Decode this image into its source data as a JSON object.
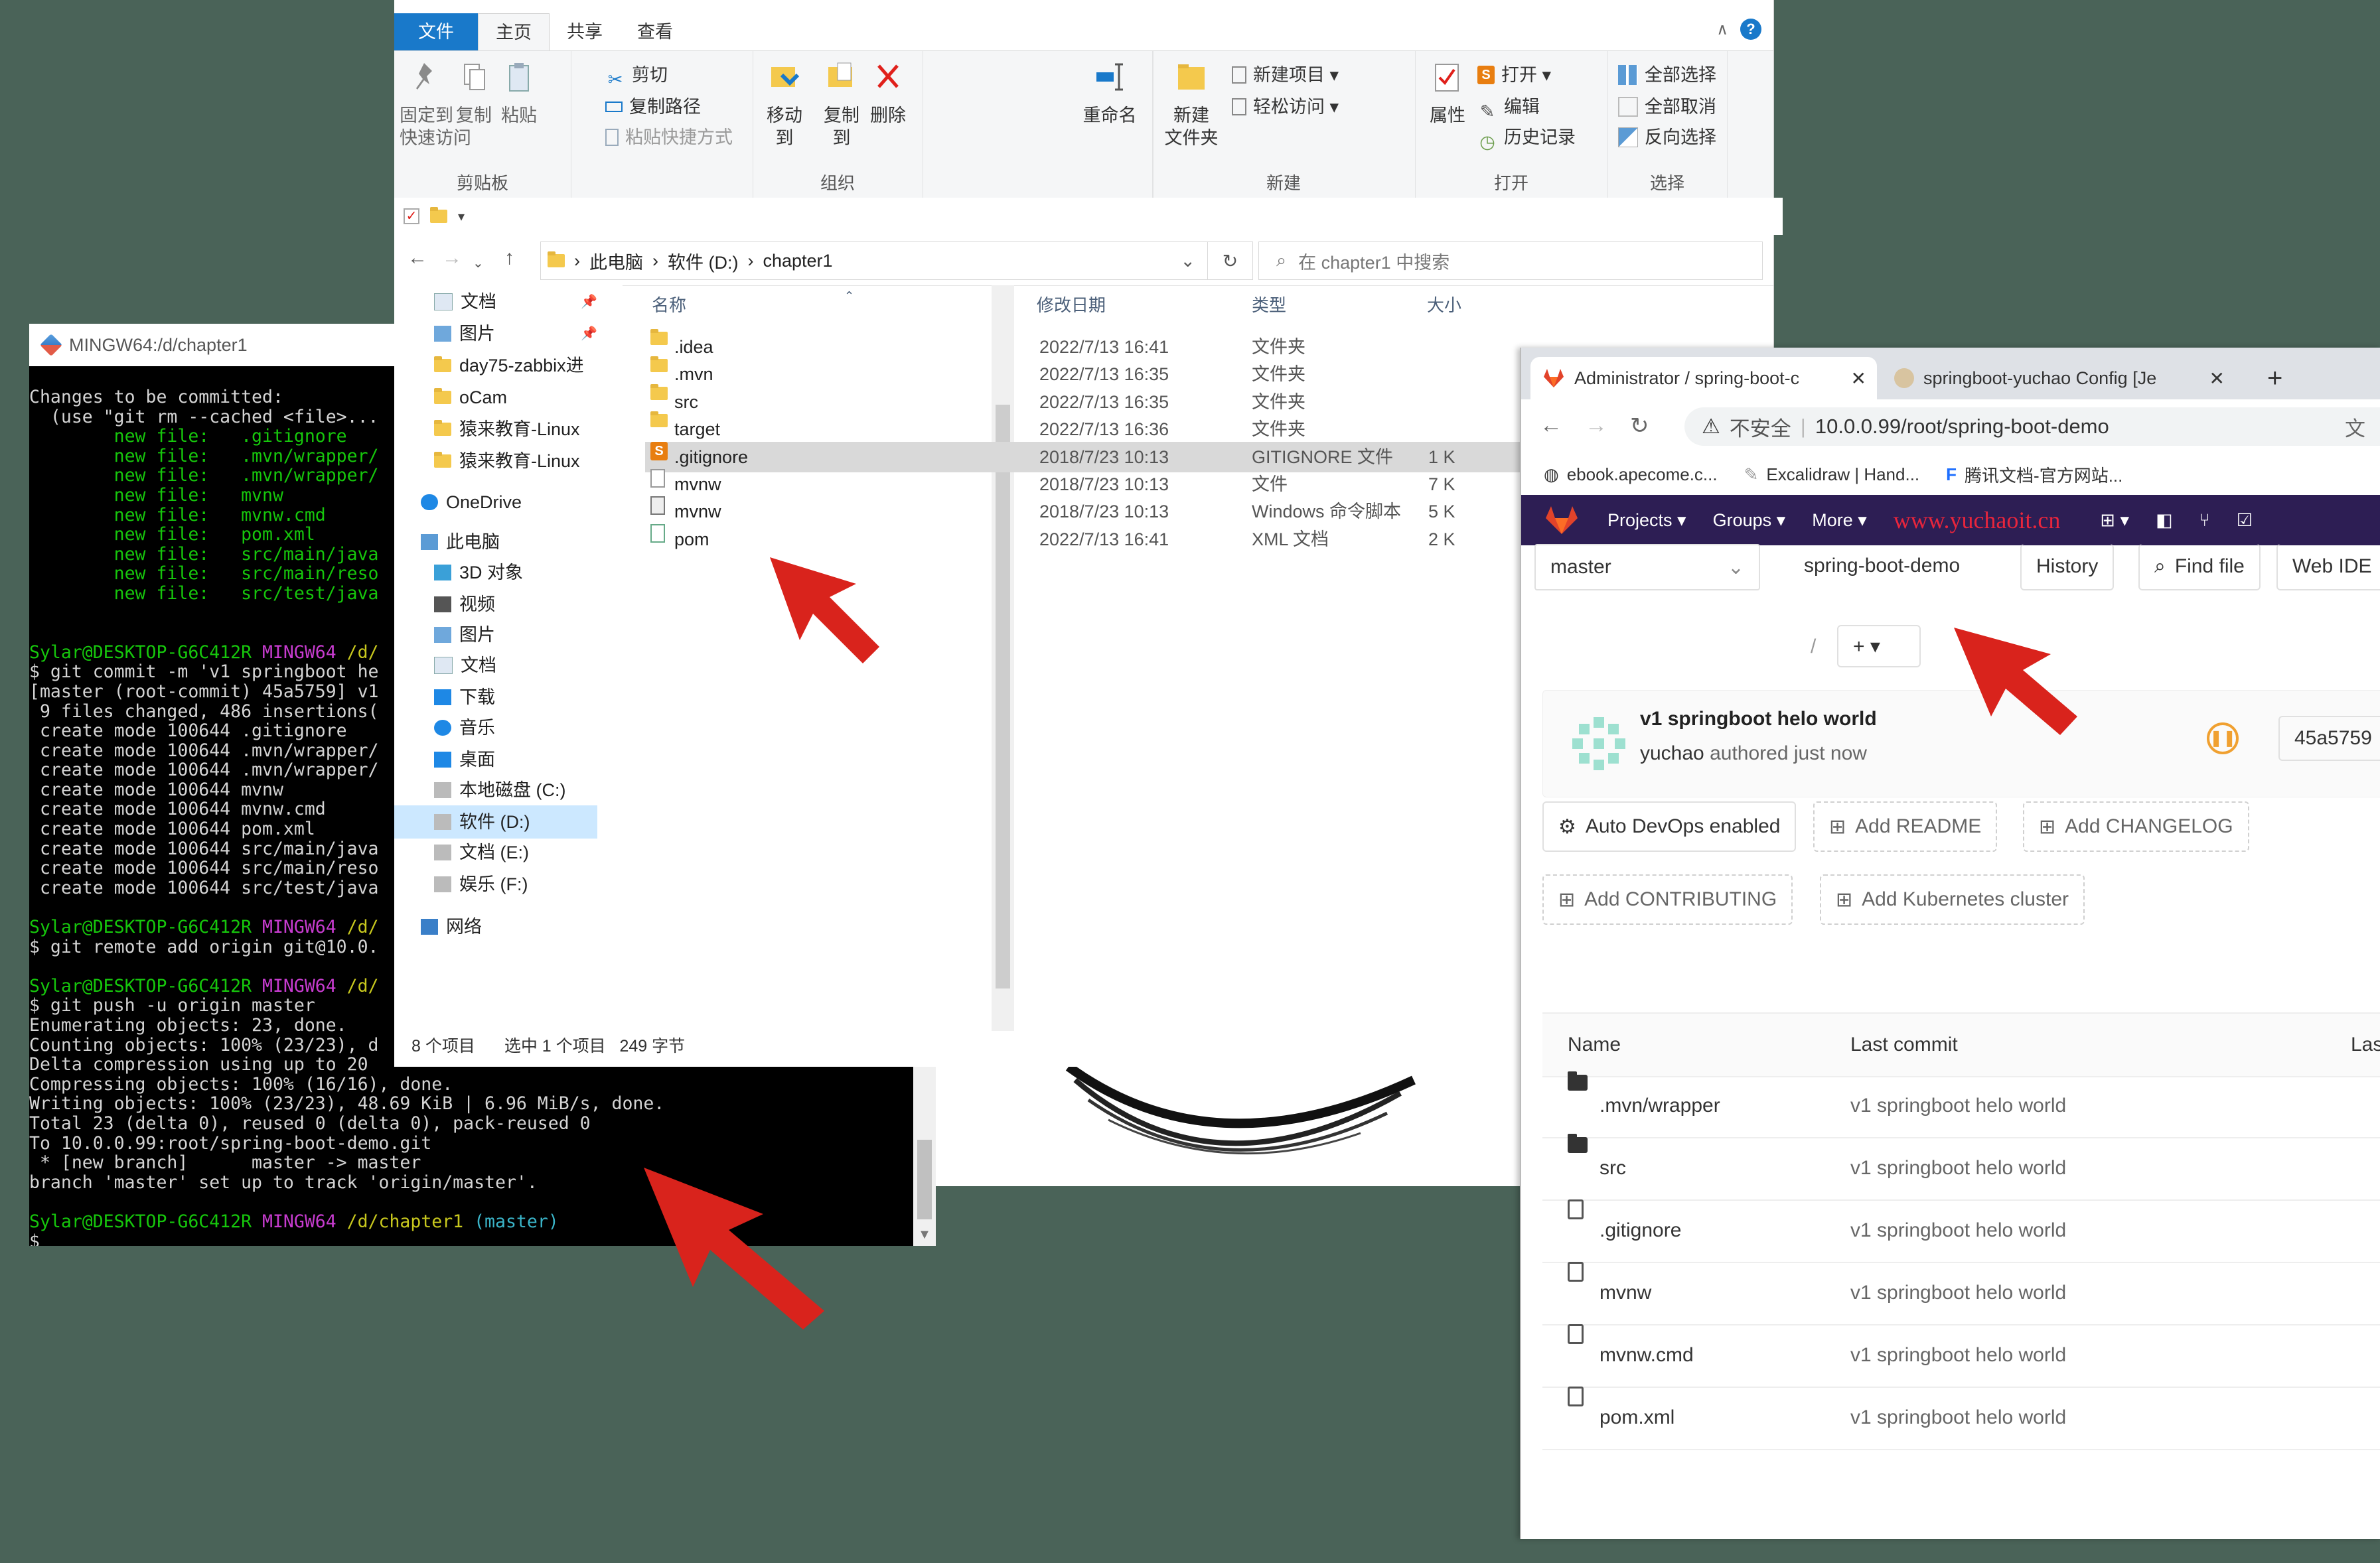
{
  "terminal": {
    "title": "MINGW64:/d/chapter1",
    "lines": [
      [
        [
          "Changes to be committed:",
          ""
        ]
      ],
      [
        [
          "  (use \"git rm --cached <file>...",
          ""
        ]
      ],
      [
        [
          "        new file:   .gitignore",
          "g"
        ]
      ],
      [
        [
          "        new file:   .mvn/wrapper/",
          "g"
        ]
      ],
      [
        [
          "        new file:   .mvn/wrapper/",
          "g"
        ]
      ],
      [
        [
          "        new file:   mvnw",
          "g"
        ]
      ],
      [
        [
          "        new file:   mvnw.cmd",
          "g"
        ]
      ],
      [
        [
          "        new file:   pom.xml",
          "g"
        ]
      ],
      [
        [
          "        new file:   src/main/java",
          "g"
        ]
      ],
      [
        [
          "        new file:   src/main/reso",
          "g"
        ]
      ],
      [
        [
          "        new file:   src/test/java",
          "g"
        ]
      ],
      [
        [
          "",
          ""
        ]
      ],
      [
        [
          "",
          ""
        ]
      ],
      [
        [
          "Sylar@DESKTOP-G6C412R ",
          "g"
        ],
        [
          "MINGW64 ",
          "p"
        ],
        [
          "/d/",
          "y"
        ]
      ],
      [
        [
          "$ git commit -m 'v1 springboot he",
          ""
        ]
      ],
      [
        [
          "[master (root-commit) 45a5759] v1",
          ""
        ]
      ],
      [
        [
          " 9 files changed, 486 insertions(",
          ""
        ]
      ],
      [
        [
          " create mode 100644 .gitignore",
          ""
        ]
      ],
      [
        [
          " create mode 100644 .mvn/wrapper/",
          ""
        ]
      ],
      [
        [
          " create mode 100644 .mvn/wrapper/",
          ""
        ]
      ],
      [
        [
          " create mode 100644 mvnw",
          ""
        ]
      ],
      [
        [
          " create mode 100644 mvnw.cmd",
          ""
        ]
      ],
      [
        [
          " create mode 100644 pom.xml",
          ""
        ]
      ],
      [
        [
          " create mode 100644 src/main/java",
          ""
        ]
      ],
      [
        [
          " create mode 100644 src/main/reso",
          ""
        ]
      ],
      [
        [
          " create mode 100644 src/test/java",
          ""
        ]
      ],
      [
        [
          "",
          ""
        ]
      ],
      [
        [
          "Sylar@DESKTOP-G6C412R ",
          "g"
        ],
        [
          "MINGW64 ",
          "p"
        ],
        [
          "/d/",
          "y"
        ]
      ],
      [
        [
          "$ git remote add origin git@10.0.",
          ""
        ]
      ],
      [
        [
          "",
          ""
        ]
      ],
      [
        [
          "Sylar@DESKTOP-G6C412R ",
          "g"
        ],
        [
          "MINGW64 ",
          "p"
        ],
        [
          "/d/",
          "y"
        ]
      ],
      [
        [
          "$ git push -u origin master",
          ""
        ]
      ],
      [
        [
          "Enumerating objects: 23, done.",
          ""
        ]
      ],
      [
        [
          "Counting objects: 100% (23/23), d",
          ""
        ]
      ],
      [
        [
          "Delta compression using up to 20",
          ""
        ]
      ],
      [
        [
          "Compressing objects: 100% (16/16), done.",
          ""
        ]
      ],
      [
        [
          "Writing objects: 100% (23/23), 48.69 KiB | 6.96 MiB/s, done.",
          ""
        ]
      ],
      [
        [
          "Total 23 (delta 0), reused 0 (delta 0), pack-reused 0",
          ""
        ]
      ],
      [
        [
          "To 10.0.0.99:root/spring-boot-demo.git",
          ""
        ]
      ],
      [
        [
          " * [new branch]      master -> master",
          ""
        ]
      ],
      [
        [
          "branch 'master' set up to track 'origin/master'.",
          ""
        ]
      ],
      [
        [
          "",
          ""
        ]
      ],
      [
        [
          "Sylar@DESKTOP-G6C412R ",
          "g"
        ],
        [
          "MINGW64 ",
          "p"
        ],
        [
          "/d/chapter1 ",
          "y"
        ],
        [
          "(master)",
          "c"
        ]
      ],
      [
        [
          "$ ",
          ""
        ]
      ]
    ]
  },
  "explorer": {
    "tabs": [
      "文件",
      "主页",
      "共享",
      "查看"
    ],
    "ribbon": {
      "clipboard": {
        "name": "剪贴板",
        "pin": "固定到\n快速访问",
        "copy": "复制",
        "paste": "粘贴",
        "cut": "剪切",
        "copy_path": "复制路径",
        "paste_shortcut": "粘贴快捷方式"
      },
      "organize": {
        "name": "组织",
        "move_to": "移动到",
        "copy_to": "复制到",
        "delete": "删除",
        "rename": "重命名"
      },
      "new": {
        "name": "新建",
        "new_folder": "新建\n文件夹",
        "new_item": "新建项目 ▾",
        "easy_access": "轻松访问 ▾"
      },
      "open": {
        "name": "打开",
        "properties": "属性",
        "open": "打开 ▾",
        "edit": "编辑",
        "history": "历史记录"
      },
      "select": {
        "name": "选择",
        "select_all": "全部选择",
        "select_none": "全部取消",
        "invert": "反向选择"
      }
    },
    "address": {
      "parts": [
        "此电脑",
        "软件 (D:)",
        "chapter1"
      ],
      "search_placeholder": "在 chapter1 中搜索"
    },
    "nav": [
      {
        "label": "文档",
        "icon": "doc-icon",
        "pinned": true
      },
      {
        "label": "图片",
        "icon": "pictures-icon",
        "pinned": true
      },
      {
        "label": "day75-zabbix进",
        "icon": "folder-icon"
      },
      {
        "label": "oCam",
        "icon": "folder-icon"
      },
      {
        "label": "猿来教育-Linux",
        "icon": "folder-icon"
      },
      {
        "label": "猿来教育-Linux",
        "icon": "folder-icon"
      },
      {
        "label": "OneDrive",
        "icon": "cloud-icon"
      },
      {
        "label": "此电脑",
        "icon": "pc-icon"
      },
      {
        "label": "3D 对象",
        "icon": "3d-icon"
      },
      {
        "label": "视频",
        "icon": "video-icon"
      },
      {
        "label": "图片",
        "icon": "pictures-icon"
      },
      {
        "label": "文档",
        "icon": "doc-icon"
      },
      {
        "label": "下载",
        "icon": "download-icon"
      },
      {
        "label": "音乐",
        "icon": "music-icon"
      },
      {
        "label": "桌面",
        "icon": "desktop-icon"
      },
      {
        "label": "本地磁盘 (C:)",
        "icon": "drive-icon"
      },
      {
        "label": "软件 (D:)",
        "icon": "drive-icon",
        "selected": true
      },
      {
        "label": "文档 (E:)",
        "icon": "drive-icon"
      },
      {
        "label": "娱乐 (F:)",
        "icon": "drive-icon"
      },
      {
        "label": "网络",
        "icon": "network-icon"
      }
    ],
    "columns": [
      "名称",
      "修改日期",
      "类型",
      "大小"
    ],
    "files": [
      {
        "name": ".idea",
        "date": "2022/7/13 16:41",
        "type": "文件夹",
        "size": "",
        "kind": "folder"
      },
      {
        "name": ".mvn",
        "date": "2022/7/13 16:35",
        "type": "文件夹",
        "size": "",
        "kind": "folder"
      },
      {
        "name": "src",
        "date": "2022/7/13 16:35",
        "type": "文件夹",
        "size": "",
        "kind": "folder"
      },
      {
        "name": "target",
        "date": "2022/7/13 16:36",
        "type": "文件夹",
        "size": "",
        "kind": "folder"
      },
      {
        "name": ".gitignore",
        "date": "2018/7/23 10:13",
        "type": "GITIGNORE 文件",
        "size": "1 K",
        "kind": "sublime",
        "selected": true
      },
      {
        "name": "mvnw",
        "date": "2018/7/23 10:13",
        "type": "文件",
        "size": "7 K",
        "kind": "doc"
      },
      {
        "name": "mvnw",
        "date": "2018/7/23 10:13",
        "type": "Windows 命令脚本",
        "size": "5 K",
        "kind": "cmd"
      },
      {
        "name": "pom",
        "date": "2022/7/13 16:41",
        "type": "XML 文档",
        "size": "2 K",
        "kind": "xml"
      }
    ],
    "status": {
      "count": "8 个项目",
      "selected": "选中 1 个项目",
      "size": "249 字节"
    }
  },
  "browser": {
    "tabs": [
      {
        "title": "Administrator / spring-boot-c",
        "active": true
      },
      {
        "title": "springboot-yuchao Config [Je",
        "active": false
      }
    ],
    "url_warning": "不安全",
    "url": "10.0.0.99/root/spring-boot-demo",
    "bookmarks": [
      "ebook.apecome.c...",
      "Excalidraw | Hand...",
      "腾讯文档-官方网站..."
    ],
    "gitlab_nav": {
      "projects": "Projects ▾",
      "groups": "Groups ▾",
      "more": "More ▾",
      "brand": "www.yuchaoit.cn"
    },
    "branch": "master",
    "project_path": "spring-boot-demo",
    "history": "History",
    "find_file": "Find file",
    "web_ide": "Web IDE",
    "slash": "/",
    "plus": "+ ▾",
    "commit": {
      "title": "v1 springboot helo world",
      "author": "yuchao",
      "meta": "authored just now",
      "sha": "45a5759"
    },
    "actions": [
      "Auto DevOps enabled",
      "Add README",
      "Add CHANGELOG",
      "Add CONTRIBUTING",
      "Add Kubernetes cluster"
    ],
    "tree_header": {
      "name": "Name",
      "last_commit": "Last commit",
      "last_update": "Las"
    },
    "tree": [
      {
        "name": ".mvn/wrapper",
        "commit": "v1 springboot helo world",
        "kind": "folder"
      },
      {
        "name": "src",
        "commit": "v1 springboot helo world",
        "kind": "folder"
      },
      {
        "name": ".gitignore",
        "commit": "v1 springboot helo world",
        "kind": "file"
      },
      {
        "name": "mvnw",
        "commit": "v1 springboot helo world",
        "kind": "file"
      },
      {
        "name": "mvnw.cmd",
        "commit": "v1 springboot helo world",
        "kind": "file"
      },
      {
        "name": "pom.xml",
        "commit": "v1 springboot helo world",
        "kind": "file"
      }
    ]
  },
  "colors": {
    "desktop": "#4a6358",
    "accent": "#1979ca",
    "gitlab_nav": "#2d1e54",
    "arrow": "#d9231c",
    "term_green": "#16c60c",
    "term_purple": "#c83cd0",
    "term_yellow": "#c8c81e"
  }
}
